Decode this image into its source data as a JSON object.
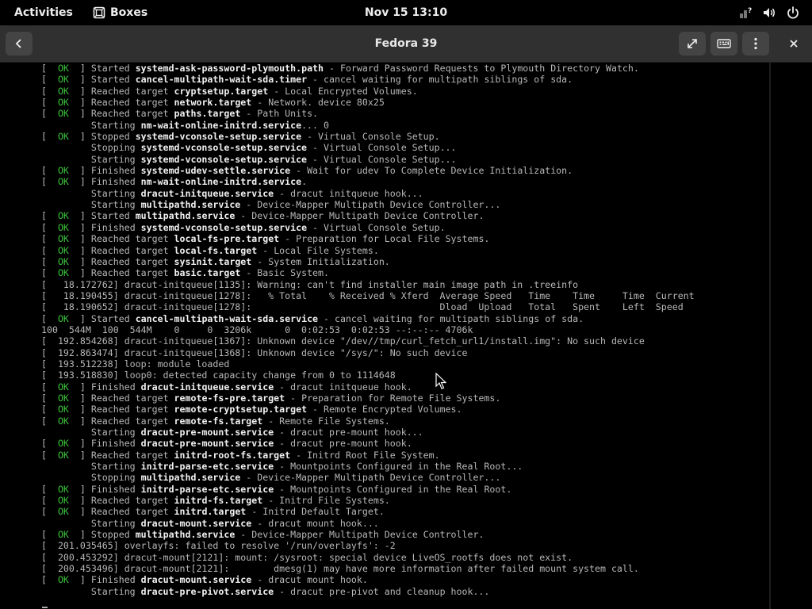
{
  "topbar": {
    "activities": "Activities",
    "app_name": "Boxes",
    "clock": "Nov 15  13:10",
    "icons": [
      "network-question-icon",
      "volume-icon",
      "power-icon"
    ]
  },
  "headerbar": {
    "title": "Fedora 39",
    "icons": [
      "back-arrow-icon",
      "fullscreen-icon",
      "keyboard-icon",
      "menu-dots-icon",
      "close-icon"
    ]
  },
  "console": {
    "lines": [
      [
        "[  ",
        "OK",
        "  ] Started ",
        "systemd-ask-password-plymouth.path",
        " - Forward Password Requests to Plymouth Directory Watch."
      ],
      [
        "[  ",
        "OK",
        "  ] Started ",
        "cancel-multipath-wait-sda.timer",
        " - cancel waiting for multipath siblings of sda."
      ],
      [
        "[  ",
        "OK",
        "  ] Reached target ",
        "cryptsetup.target",
        " - Local Encrypted Volumes."
      ],
      [
        "[  ",
        "OK",
        "  ] Reached target ",
        "network.target",
        " - Network. device 80x25"
      ],
      [
        "[  ",
        "OK",
        "  ] Reached target ",
        "paths.target",
        " - Path Units."
      ],
      [
        "",
        "",
        "         Starting ",
        "nm-wait-online-initrd.service",
        "... 0"
      ],
      [
        "[  ",
        "OK",
        "  ] Stopped ",
        "systemd-vconsole-setup.service",
        " - Virtual Console Setup."
      ],
      [
        "",
        "",
        "         Stopping ",
        "systemd-vconsole-setup.service",
        " - Virtual Console Setup..."
      ],
      [
        "",
        "",
        "         Starting ",
        "systemd-vconsole-setup.service",
        " - Virtual Console Setup..."
      ],
      [
        "[  ",
        "OK",
        "  ] Finished ",
        "systemd-udev-settle.service",
        " - Wait for udev To Complete Device Initialization."
      ],
      [
        "[  ",
        "OK",
        "  ] Finished ",
        "nm-wait-online-initrd.service",
        "."
      ],
      [
        "",
        "",
        "         Starting ",
        "dracut-initqueue.service",
        " - dracut initqueue hook..."
      ],
      [
        "",
        "",
        "         Starting ",
        "multipathd.service",
        " - Device-Mapper Multipath Device Controller..."
      ],
      [
        "[  ",
        "OK",
        "  ] Started ",
        "multipathd.service",
        " - Device-Mapper Multipath Device Controller."
      ],
      [
        "[  ",
        "OK",
        "  ] Finished ",
        "systemd-vconsole-setup.service",
        " - Virtual Console Setup."
      ],
      [
        "[  ",
        "OK",
        "  ] Reached target ",
        "local-fs-pre.target",
        " - Preparation for Local File Systems."
      ],
      [
        "[  ",
        "OK",
        "  ] Reached target ",
        "local-fs.target",
        " - Local File Systems."
      ],
      [
        "[  ",
        "OK",
        "  ] Reached target ",
        "sysinit.target",
        " - System Initialization."
      ],
      [
        "[  ",
        "OK",
        "  ] Reached target ",
        "basic.target",
        " - Basic System."
      ],
      [
        "[   18.172762] dracut-initqueue[1135]: Warning: can't find installer main image path in .treeinfo",
        "",
        "",
        "",
        ""
      ],
      [
        "[   18.190455] dracut-initqueue[1278]:   % Total    % Received % Xferd  Average Speed   Time    Time     Time  Current",
        "",
        "",
        "",
        ""
      ],
      [
        "[   18.190652] dracut-initqueue[1278]:                                  Dload  Upload   Total   Spent    Left  Speed",
        "",
        "",
        "",
        ""
      ],
      [
        "[  ",
        "OK",
        "  ] Started ",
        "cancel-multipath-wait-sda.service",
        " - cancel waiting for multipath siblings of sda."
      ],
      [
        "100  544M  100  544M    0     0  3206k      0  0:02:53  0:02:53 --:--:-- 4706k",
        "",
        "",
        "",
        ""
      ],
      [
        "[  192.854268] dracut-initqueue[1367]: Unknown device \"/dev//tmp/curl_fetch_url1/install.img\": No such device",
        "",
        "",
        "",
        ""
      ],
      [
        "[  192.863474] dracut-initqueue[1368]: Unknown device \"/sys/\": No such device",
        "",
        "",
        "",
        ""
      ],
      [
        "[  193.512238] loop: module loaded",
        "",
        "",
        "",
        ""
      ],
      [
        "[  193.518830] loop0: detected capacity change from 0 to 1114648",
        "",
        "",
        "",
        ""
      ],
      [
        "[  ",
        "OK",
        "  ] Finished ",
        "dracut-initqueue.service",
        " - dracut initqueue hook."
      ],
      [
        "[  ",
        "OK",
        "  ] Reached target ",
        "remote-fs-pre.target",
        " - Preparation for Remote File Systems."
      ],
      [
        "[  ",
        "OK",
        "  ] Reached target ",
        "remote-cryptsetup.target",
        " - Remote Encrypted Volumes."
      ],
      [
        "[  ",
        "OK",
        "  ] Reached target ",
        "remote-fs.target",
        " - Remote File Systems."
      ],
      [
        "",
        "",
        "         Starting ",
        "dracut-pre-mount.service",
        " - dracut pre-mount hook..."
      ],
      [
        "[  ",
        "OK",
        "  ] Finished ",
        "dracut-pre-mount.service",
        " - dracut pre-mount hook."
      ],
      [
        "[  ",
        "OK",
        "  ] Reached target ",
        "initrd-root-fs.target",
        " - Initrd Root File System."
      ],
      [
        "",
        "",
        "         Starting ",
        "initrd-parse-etc.service",
        " - Mountpoints Configured in the Real Root..."
      ],
      [
        "",
        "",
        "         Stopping ",
        "multipathd.service",
        " - Device-Mapper Multipath Device Controller..."
      ],
      [
        "[  ",
        "OK",
        "  ] Finished ",
        "initrd-parse-etc.service",
        " - Mountpoints Configured in the Real Root."
      ],
      [
        "[  ",
        "OK",
        "  ] Reached target ",
        "initrd-fs.target",
        " - Initrd File Systems."
      ],
      [
        "[  ",
        "OK",
        "  ] Reached target ",
        "initrd.target",
        " - Initrd Default Target."
      ],
      [
        "",
        "",
        "         Starting ",
        "dracut-mount.service",
        " - dracut mount hook..."
      ],
      [
        "[  ",
        "OK",
        "  ] Stopped ",
        "multipathd.service",
        " - Device-Mapper Multipath Device Controller."
      ],
      [
        "[  201.035465] overlayfs: failed to resolve '/run/overlayfs': -2",
        "",
        "",
        "",
        ""
      ],
      [
        "[  200.453292] dracut-mount[2121]: mount: /sysroot: special device LiveOS_rootfs does not exist.",
        "",
        "",
        "",
        ""
      ],
      [
        "[  200.453496] dracut-mount[2121]:        dmesg(1) may have more information after failed mount system call.",
        "",
        "",
        "",
        ""
      ],
      [
        "[  ",
        "OK",
        "  ] Finished ",
        "dracut-mount.service",
        " - dracut mount hook."
      ],
      [
        "",
        "",
        "         Starting ",
        "dracut-pre-pivot.service",
        " - dracut pre-pivot and cleanup hook..."
      ]
    ]
  }
}
